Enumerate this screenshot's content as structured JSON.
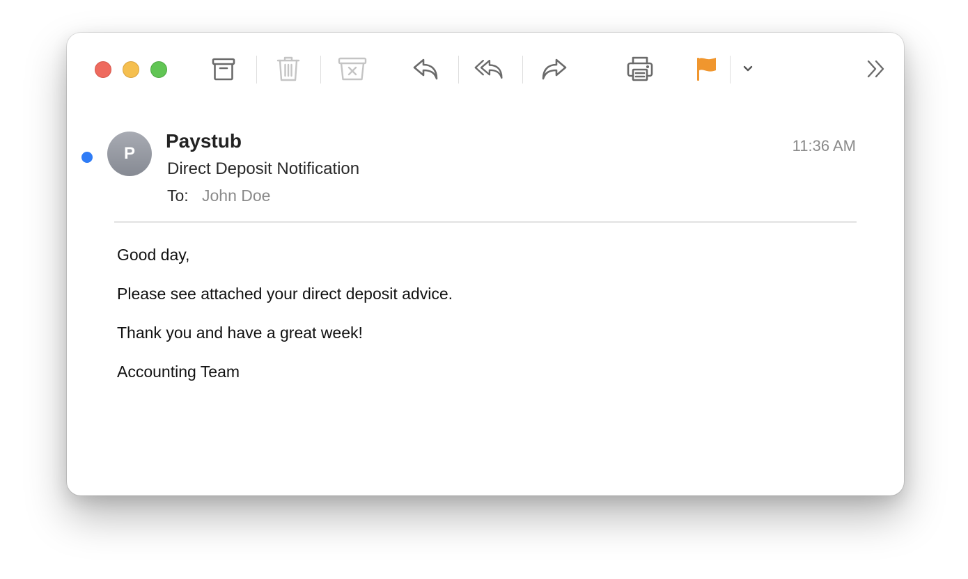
{
  "toolbar": {
    "buttons": [
      {
        "name": "archive",
        "icon": "archive-icon"
      },
      {
        "name": "delete",
        "icon": "trash-icon",
        "enabled": false
      },
      {
        "name": "junk",
        "icon": "junk-icon",
        "enabled": false
      },
      {
        "name": "reply",
        "icon": "reply-icon"
      },
      {
        "name": "reply-all",
        "icon": "reply-all-icon"
      },
      {
        "name": "forward",
        "icon": "forward-icon"
      },
      {
        "name": "print",
        "icon": "printer-icon"
      },
      {
        "name": "flag",
        "icon": "flag-icon",
        "color": "#f0962e"
      },
      {
        "name": "flag-menu",
        "icon": "chevron-down-icon"
      },
      {
        "name": "more",
        "icon": "double-chevron-right-icon"
      }
    ]
  },
  "colors": {
    "unread_dot": "#2f7cf6",
    "flag": "#f0962e",
    "close": "#ee6a5e",
    "minimize": "#f5bf4f",
    "zoom": "#61c554"
  },
  "message": {
    "avatar_initial": "P",
    "sender": "Paystub",
    "subject": "Direct Deposit Notification",
    "to_label": "To:",
    "to_value": "John Doe",
    "time": "11:36 AM",
    "unread": true,
    "body": [
      "Good day,",
      "Please see attached your direct deposit advice.",
      "Thank you and have a great week!",
      "Accounting Team"
    ]
  }
}
